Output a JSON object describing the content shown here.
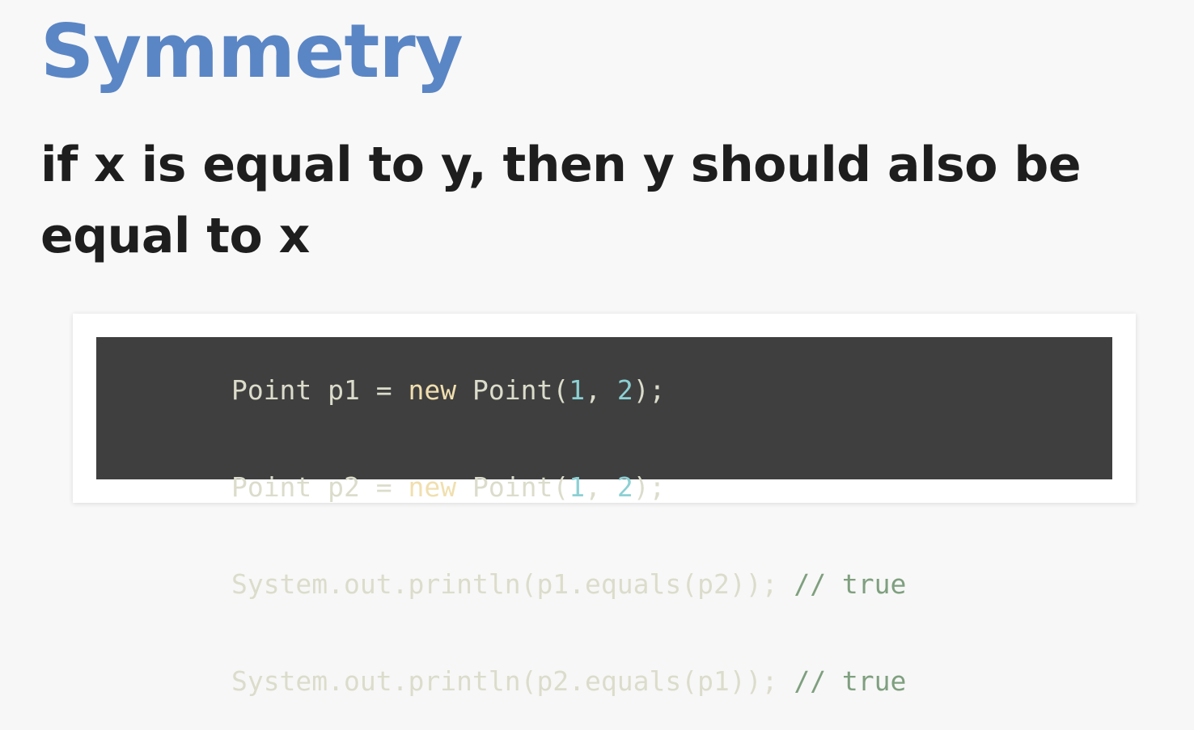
{
  "slide": {
    "title": "Symmetry",
    "subtitle": "if x is equal to y, then y should also be equal to x"
  },
  "code": {
    "lines": [
      [
        {
          "text": "Point p1 = ",
          "kind": "plain"
        },
        {
          "text": "new",
          "kind": "keyword"
        },
        {
          "text": " Point(",
          "kind": "plain"
        },
        {
          "text": "1",
          "kind": "number"
        },
        {
          "text": ", ",
          "kind": "plain"
        },
        {
          "text": "2",
          "kind": "number"
        },
        {
          "text": ");",
          "kind": "plain"
        }
      ],
      [
        {
          "text": "Point p2 = ",
          "kind": "plain"
        },
        {
          "text": "new",
          "kind": "keyword"
        },
        {
          "text": " Point(",
          "kind": "plain"
        },
        {
          "text": "1",
          "kind": "number"
        },
        {
          "text": ", ",
          "kind": "plain"
        },
        {
          "text": "2",
          "kind": "number"
        },
        {
          "text": ");",
          "kind": "plain"
        }
      ],
      [
        {
          "text": "System.out.println(p1.equals(p2)); ",
          "kind": "plain"
        },
        {
          "text": "// true",
          "kind": "comment"
        }
      ],
      [
        {
          "text": "System.out.println(p2.equals(p1)); ",
          "kind": "plain"
        },
        {
          "text": "// true",
          "kind": "comment"
        }
      ]
    ]
  },
  "colors": {
    "title": "#5b86c5",
    "subtitle": "#1e1e1e",
    "code_background": "#3f3f3f",
    "code_plain": "#dcdccc",
    "code_keyword": "#f0dfaf",
    "code_number": "#8cd0d3",
    "code_comment": "#7f9f7f"
  }
}
